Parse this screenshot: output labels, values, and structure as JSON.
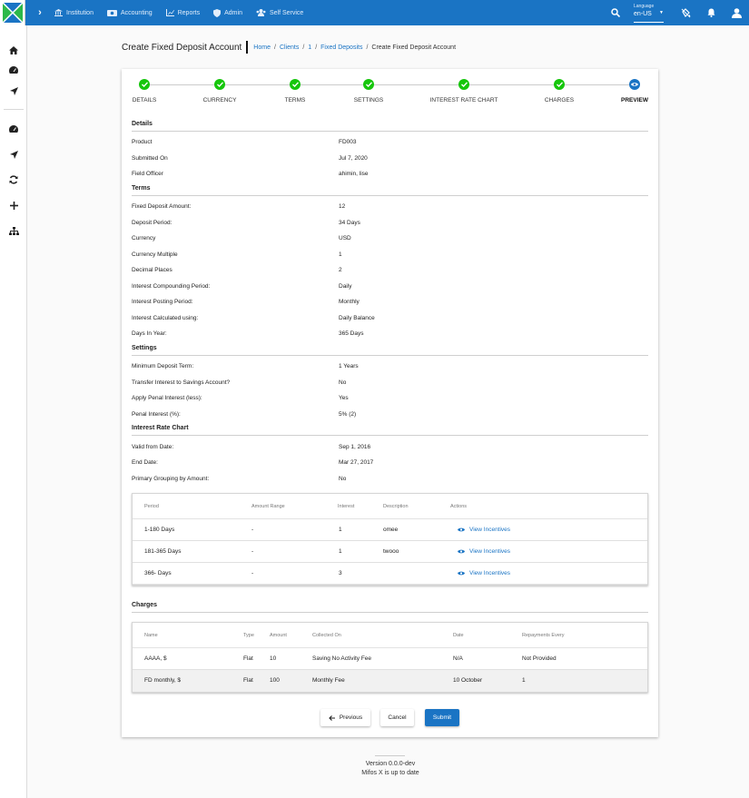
{
  "topbar": {
    "nav": [
      "Institution",
      "Accounting",
      "Reports",
      "Admin",
      "Self Service"
    ],
    "language_label": "Language",
    "language_value": "en-US"
  },
  "colors": {
    "primary": "#1a74c4",
    "success": "#16c60c",
    "logo_green": "#2db84a",
    "logo_blue": "#1a74c4"
  },
  "page": {
    "title": "Create Fixed Deposit Account",
    "breadcrumbs": [
      "Home",
      "Clients",
      "1",
      "Fixed Deposits"
    ],
    "breadcrumb_current": "Create Fixed Deposit Account"
  },
  "steps": [
    {
      "label": "DETAILS",
      "state": "done"
    },
    {
      "label": "CURRENCY",
      "state": "done"
    },
    {
      "label": "TERMS",
      "state": "done"
    },
    {
      "label": "SETTINGS",
      "state": "done"
    },
    {
      "label": "INTEREST RATE CHART",
      "state": "done"
    },
    {
      "label": "CHARGES",
      "state": "done"
    },
    {
      "label": "PREVIEW",
      "state": "active"
    }
  ],
  "details": {
    "heading": "Details",
    "rows": [
      {
        "k": "Product",
        "v": "FD003"
      },
      {
        "k": "Submitted On",
        "v": "Jul 7, 2020"
      },
      {
        "k": "Field Officer",
        "v": "ahimin, lise"
      }
    ]
  },
  "terms": {
    "heading": "Terms",
    "rows": [
      {
        "k": "Fixed Deposit Amount:",
        "v": "12"
      },
      {
        "k": "Deposit Period:",
        "v": "34 Days"
      },
      {
        "k": "Currency",
        "v": "USD"
      },
      {
        "k": "Currency Multiple",
        "v": "1"
      },
      {
        "k": "Decimal Places",
        "v": "2"
      },
      {
        "k": "Interest Compounding Period:",
        "v": "Daily"
      },
      {
        "k": "Interest Posting Period:",
        "v": "Monthly"
      },
      {
        "k": "Interest Calculated using:",
        "v": "Daily Balance"
      },
      {
        "k": "Days In Year:",
        "v": "365 Days"
      }
    ]
  },
  "settings": {
    "heading": "Settings",
    "rows": [
      {
        "k": "Minimum Deposit Term:",
        "v": "1 Years"
      },
      {
        "k": "Transfer Interest to Savings Account?",
        "v": "No"
      },
      {
        "k": "Apply Penal Interest (less):",
        "v": "Yes"
      },
      {
        "k": "Penal Interest (%):",
        "v": "5% (2)"
      }
    ]
  },
  "chart": {
    "heading": "Interest Rate Chart",
    "rows": [
      {
        "k": "Valid from Date:",
        "v": "Sep 1, 2016"
      },
      {
        "k": "End Date:",
        "v": "Mar 27, 2017"
      },
      {
        "k": "Primary Grouping by Amount:",
        "v": "No"
      }
    ],
    "columns": [
      "Period",
      "Amount Range",
      "Interest",
      "Description",
      "Actions"
    ],
    "data": [
      {
        "period": "1-180 Days",
        "range": "-",
        "interest": "1",
        "desc": "omee",
        "action": "View Incentives"
      },
      {
        "period": "181-365 Days",
        "range": "-",
        "interest": "1",
        "desc": "twooo",
        "action": "View Incentives"
      },
      {
        "period": "366- Days",
        "range": "-",
        "interest": "3",
        "desc": "",
        "action": "View Incentives"
      }
    ]
  },
  "charges": {
    "heading": "Charges",
    "columns": [
      "Name",
      "Type",
      "Amount",
      "Collected On",
      "Date",
      "Repayments Every"
    ],
    "data": [
      {
        "name": "AAAA, $",
        "type": "Flat",
        "amount": "10",
        "collected": "Saving No Activity Fee",
        "date": "N/A",
        "every": "Not Provided"
      },
      {
        "name": "FD monthly, $",
        "type": "Flat",
        "amount": "100",
        "collected": "Monthly Fee",
        "date": "10 October",
        "every": "1"
      }
    ]
  },
  "buttons": {
    "previous": "Previous",
    "cancel": "Cancel",
    "submit": "Submit"
  },
  "footer": {
    "version": "Version 0.0.0-dev",
    "status": "Mifos X is up to date"
  }
}
